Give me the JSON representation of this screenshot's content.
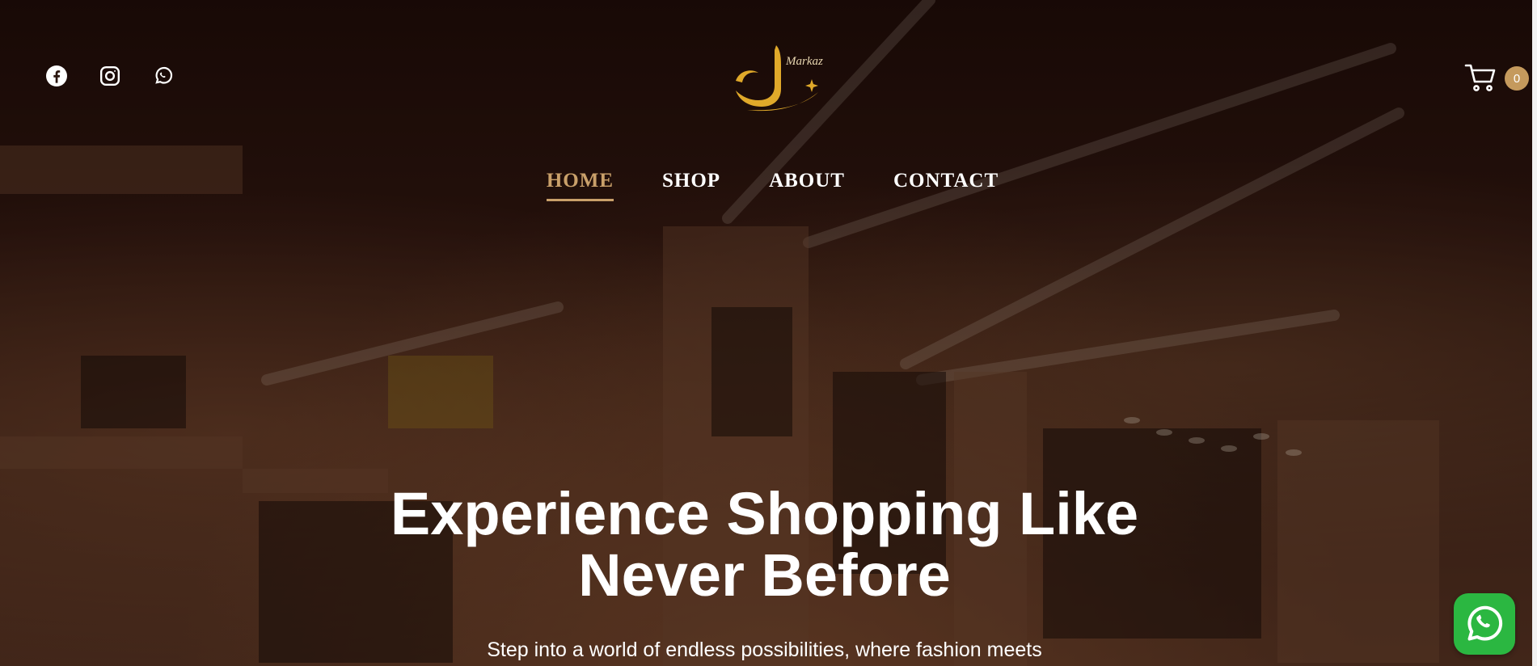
{
  "header": {
    "social": [
      {
        "name": "facebook-icon"
      },
      {
        "name": "instagram-icon"
      },
      {
        "name": "whatsapp-icon"
      }
    ],
    "logo_text": "Markaz",
    "cart_count": "0"
  },
  "nav": {
    "items": [
      "HOME",
      "SHOP",
      "ABOUT",
      "CONTACT"
    ],
    "active": "HOME"
  },
  "hero": {
    "title": "Experience Shopping Like Never Before",
    "subtitle": "Step into a world of endless possibilities, where fashion meets"
  },
  "colors": {
    "accent": "#c9a06a",
    "logo_gold": "#e0a92a",
    "badge": "#c59a5d",
    "whatsapp_green": "#2bb741"
  }
}
